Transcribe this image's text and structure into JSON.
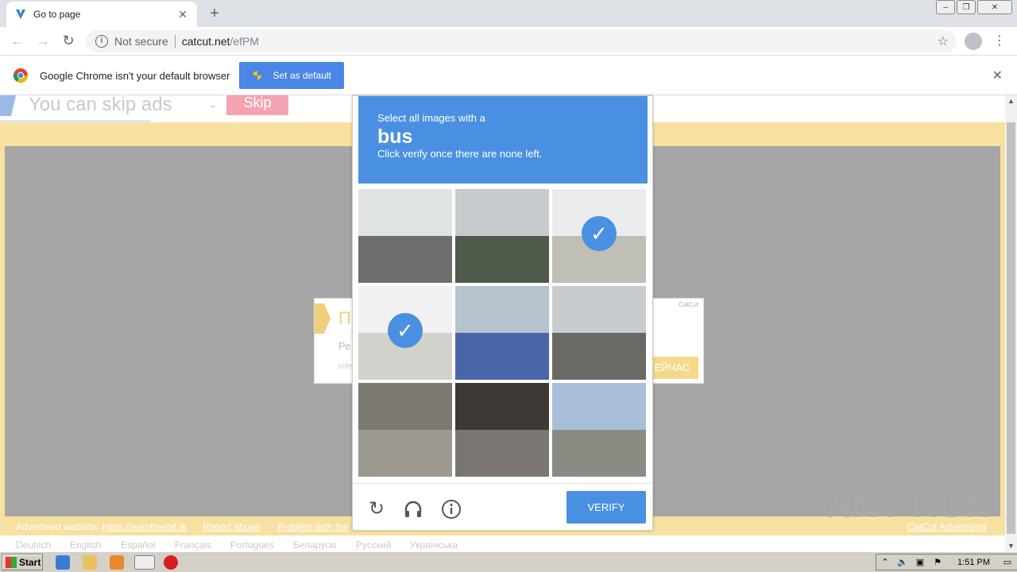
{
  "browser": {
    "tab_title": "Go to page",
    "url_security": "Not secure",
    "url_host": "catcut.net",
    "url_path": "/efPM"
  },
  "infobar": {
    "message": "Google Chrome isn't your default browser",
    "button": "Set as default"
  },
  "page": {
    "skip_text": "You can skip ads",
    "skip_dash": "-",
    "skip_button": "Skip",
    "ad": {
      "title": "П",
      "text": "Ре",
      "small": "refe",
      "brand": "CatCut",
      "button": "ЕЙЧАС"
    },
    "footer": {
      "advertised_label": "Advertised website:",
      "advertised_link": "https://earnfreebit.tk",
      "report": "Report abuse",
      "problem": "Problem with the",
      "catcut_ads": "CatCut Advertising"
    },
    "languages": [
      "Deutsch",
      "English",
      "Español",
      "Français",
      "Portugues",
      "Беларускі",
      "Русский",
      "Українська"
    ]
  },
  "captcha": {
    "line1": "Select all images with a",
    "keyword": "bus",
    "line3": "Click verify once there are none left.",
    "verify_button": "VERIFY",
    "accent": "#4a90e2",
    "tiles": [
      {
        "selected": false,
        "sky": "#dfe3e4",
        "ground": "#6e6e6e"
      },
      {
        "selected": false,
        "sky": "#c8cbcd",
        "ground": "#4f5a4a"
      },
      {
        "selected": true,
        "sky": "#d9dde0",
        "ground": "#8a8a7a"
      },
      {
        "selected": true,
        "sky": "#e5e5e5",
        "ground": "#b0aca0"
      },
      {
        "selected": false,
        "sky": "#b7c3cc",
        "ground": "#4a66a8"
      },
      {
        "selected": false,
        "sky": "#c9ccce",
        "ground": "#6a6a64"
      },
      {
        "selected": false,
        "sky": "#7d7a72",
        "ground": "#9c9990"
      },
      {
        "selected": false,
        "sky": "#3d3a36",
        "ground": "#7a7672"
      },
      {
        "selected": false,
        "sky": "#a9bfd9",
        "ground": "#8b8b84"
      }
    ]
  },
  "watermark": "ANY RUN",
  "taskbar": {
    "start": "Start",
    "time": "1:51 PM"
  }
}
